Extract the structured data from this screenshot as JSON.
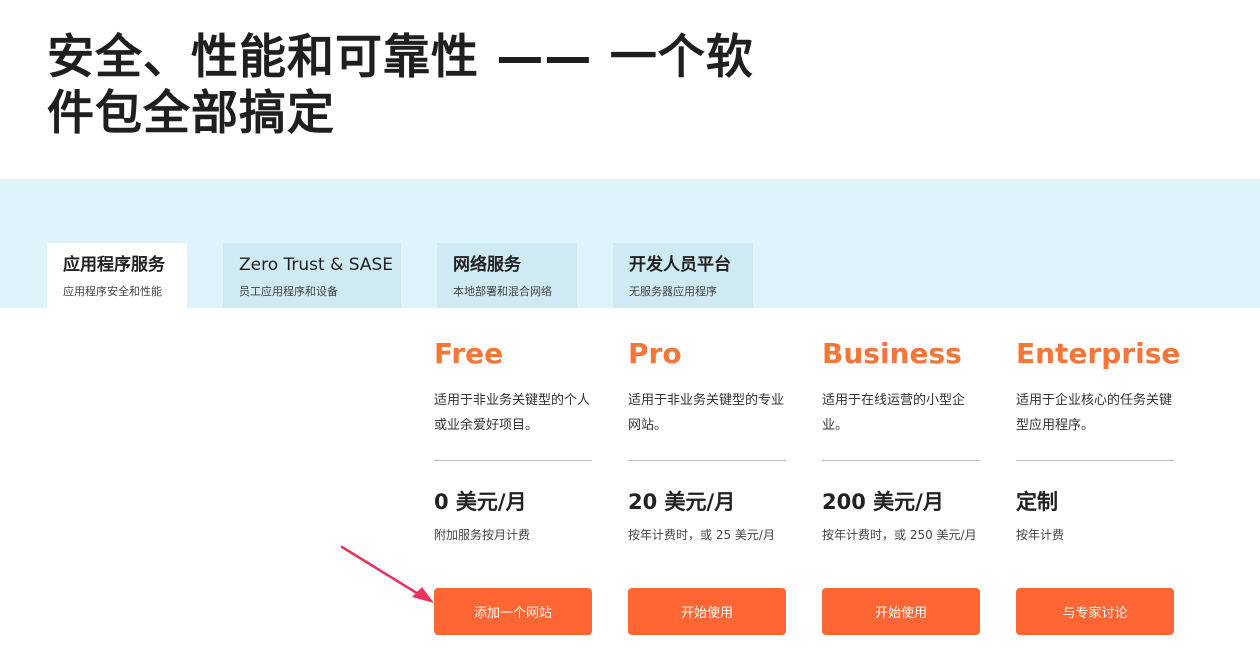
{
  "headline": {
    "line1": "安全、性能和可靠性 —— 一个软",
    "line2": "件包全部搞定"
  },
  "tabs": [
    {
      "label": "应用程序服务",
      "sublabel": "应用程序安全和性能",
      "active": true
    },
    {
      "label": "Zero Trust & SASE",
      "sublabel": "员工应用程序和设备",
      "active": false
    },
    {
      "label": "网络服务",
      "sublabel": "本地部署和混合网络",
      "active": false
    },
    {
      "label": "开发人员平台",
      "sublabel": "无服务器应用程序",
      "active": false
    }
  ],
  "plans": [
    {
      "name": "Free",
      "description": "适用于非业务关键型的个人或业余爱好项目。",
      "price": "0 美元/月",
      "billing": "附加服务按月计费",
      "button": "添加一个网站"
    },
    {
      "name": "Pro",
      "description": "适用于非业务关键型的专业网站。",
      "price": "20 美元/月",
      "billing": "按年计费时，或 25 美元/月",
      "button": "开始使用"
    },
    {
      "name": "Business",
      "description": "适用于在线运营的小型企业。",
      "price": "200 美元/月",
      "billing": "按年计费时，或 250 美元/月",
      "button": "开始使用"
    },
    {
      "name": "Enterprise",
      "description": "适用于企业核心的任务关键型应用程序。",
      "price": "定制",
      "billing": "按年计费",
      "button": "与专家讨论"
    }
  ],
  "colors": {
    "accent": "#ff6633",
    "plan_name": "#f6763a",
    "band": "#dff3fa",
    "arrow": "#e8335a"
  },
  "annotation": {
    "icon": "pointer-arrow-icon"
  }
}
